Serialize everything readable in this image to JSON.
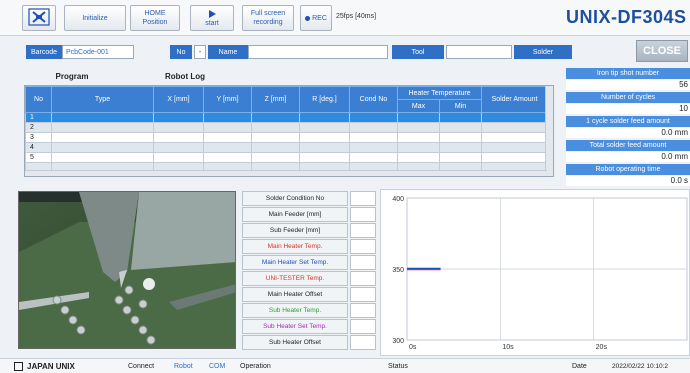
{
  "toolbar": {
    "initialize_label": "Initialize",
    "home_line1": "HOME",
    "home_line2": "Position",
    "start_label": "start",
    "fullscreen_line1": "Full screen",
    "fullscreen_line2": "recording",
    "rec_label": "REC",
    "fps_label": "25fps [40ms]",
    "model_title": "UNIX-DF304S"
  },
  "barcode_row": {
    "barcode_label": "Barcode",
    "barcode_value": "PcbCode-001",
    "no_label": "No",
    "no_separator": "-",
    "name_label": "Name",
    "tool_label": "Tool",
    "solder_label": "Solder"
  },
  "close_label": "CLOSE",
  "tabs": {
    "program": "Program",
    "robot_log": "Robot Log"
  },
  "program_table": {
    "columns": [
      "No",
      "Type",
      "X [mm]",
      "Y [mm]",
      "Z [mm]",
      "R [deg.]",
      "Cond No",
      "Heater Temperature",
      "Solder Amount"
    ],
    "sub_columns": [
      "Max",
      "Min"
    ],
    "row_numbers": [
      "1",
      "2",
      "3",
      "4",
      "5"
    ]
  },
  "stats": {
    "iron_tip_label": "Iron tip shot number",
    "iron_tip_value": "56",
    "cycles_label": "Number of cycles",
    "cycles_value": "10",
    "cycle_feed_label": "1 cycle solder feed amount",
    "cycle_feed_value": "0.0 mm",
    "total_feed_label": "Total solder feed amount",
    "total_feed_value": "0.0 mm",
    "robot_time_label": "Robot operating time",
    "robot_time_value": "0.0 s"
  },
  "params": [
    {
      "label": "Solder Condition No",
      "color": "#222222"
    },
    {
      "label": "Main Feeder [mm]",
      "color": "#222222"
    },
    {
      "label": "Sub Feeder [mm]",
      "color": "#222222"
    },
    {
      "label": "Main Heater Temp.",
      "color": "#d8322a"
    },
    {
      "label": "Main Heater Set Temp.",
      "color": "#1e4fb8"
    },
    {
      "label": "UNI-TESTER Temp.",
      "color": "#d8322a"
    },
    {
      "label": "Main Heater Offset",
      "color": "#222222"
    },
    {
      "label": "Sub Heater Temp.",
      "color": "#2e9a3c"
    },
    {
      "label": "Sub Heater Set Temp.",
      "color": "#9b2fae"
    },
    {
      "label": "Sub Heater Offset",
      "color": "#222222"
    }
  ],
  "chart_data": {
    "type": "line",
    "y_ticks": [
      "400",
      "350",
      "300"
    ],
    "x_ticks": [
      "0s",
      "10s",
      "20s"
    ],
    "ylim": [
      300,
      400
    ],
    "xlim": [
      0,
      30
    ],
    "grid": true,
    "series": [
      {
        "color": "#1e4fb8",
        "x": [
          0,
          3.6
        ],
        "y": [
          350,
          350
        ]
      },
      {
        "color": "#d8322a",
        "x": [
          0,
          3.6
        ],
        "y": [
          350,
          350
        ]
      }
    ]
  },
  "status_bar": {
    "brand": "JAPAN UNIX",
    "connect_label": "Connect",
    "robot_label": "Robot",
    "com_label": "COM",
    "operation_label": "Operation",
    "status_label": "Status",
    "date_label": "Date",
    "date_value": "2022/02/22 10:10:2"
  },
  "colors": {
    "accent": "#2f6fc6",
    "title": "#1e4f9c",
    "selected_row": "#2f8be0"
  }
}
